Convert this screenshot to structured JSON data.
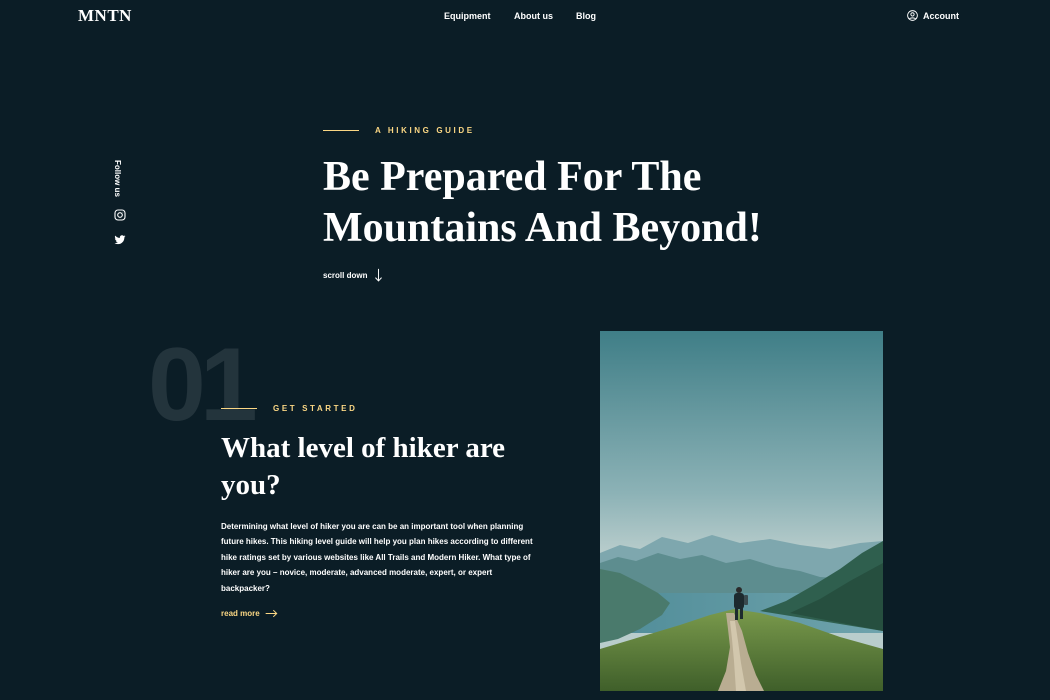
{
  "header": {
    "logo": "MNTN",
    "nav": [
      "Equipment",
      "About us",
      "Blog"
    ],
    "account_label": "Account"
  },
  "social": {
    "follow_label": "Follow us",
    "icons": [
      "instagram-icon",
      "twitter-icon"
    ]
  },
  "hero": {
    "eyebrow": "A HIKING GUIDE",
    "title": "Be Prepared For The Mountains And Beyond!",
    "scroll_label": "scroll down"
  },
  "section": {
    "number": "01",
    "eyebrow": "GET STARTED",
    "title": "What level of hiker are you?",
    "body": "Determining what level of hiker you are can be an important tool when planning future hikes. This hiking level guide will help you plan hikes according to different hike ratings set by various websites like All Trails and Modern Hiker. What type of hiker are you – novice, moderate, advanced moderate, expert, or expert backpacker?",
    "read_more": "read more"
  },
  "colors": {
    "background": "#0b1d26",
    "accent": "#fbd784",
    "text": "#ffffff"
  }
}
